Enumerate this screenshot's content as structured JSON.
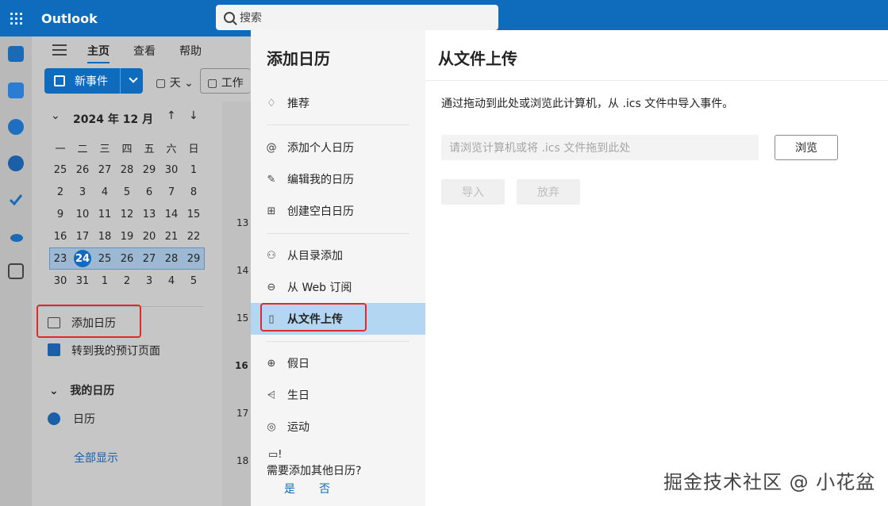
{
  "app": {
    "title": "Outlook"
  },
  "search": {
    "placeholder": "搜索"
  },
  "ribbon": {
    "tabs": [
      "主页",
      "查看",
      "帮助"
    ],
    "new_event": "新事件",
    "day": "天",
    "work": "工作"
  },
  "mini_calendar": {
    "header": "2024 年 12 月",
    "weekdays": [
      "一",
      "二",
      "三",
      "四",
      "五",
      "六",
      "日"
    ],
    "days": [
      "25",
      "26",
      "27",
      "28",
      "29",
      "30",
      "1",
      "2",
      "3",
      "4",
      "5",
      "6",
      "7",
      "8",
      "9",
      "10",
      "11",
      "12",
      "13",
      "14",
      "15",
      "16",
      "17",
      "18",
      "19",
      "20",
      "21",
      "22",
      "23",
      "24",
      "25",
      "26",
      "27",
      "28",
      "29",
      "30",
      "31",
      "1",
      "2",
      "3",
      "4",
      "5"
    ],
    "today": "24"
  },
  "sidebar": {
    "add_calendar": "添加日历",
    "goto_booking": "转到我的预订页面",
    "my_calendars": "我的日历",
    "calendar": "日历",
    "show_all": "全部显示"
  },
  "bg_rows": [
    "13",
    "14",
    "15",
    "16",
    "17",
    "18"
  ],
  "panel": {
    "title": "添加日历",
    "items": [
      {
        "label": "推荐",
        "icon": "lightbulb-icon"
      },
      {
        "label": "添加个人日历",
        "icon": "at-icon"
      },
      {
        "label": "编辑我的日历",
        "icon": "edit-calendar-icon"
      },
      {
        "label": "创建空白日历",
        "icon": "calendar-add-icon"
      },
      {
        "label": "从目录添加",
        "icon": "people-icon"
      },
      {
        "label": "从 Web 订阅",
        "icon": "link-icon"
      },
      {
        "label": "从文件上传",
        "icon": "file-upload-icon"
      },
      {
        "label": "假日",
        "icon": "globe-icon"
      },
      {
        "label": "生日",
        "icon": "cake-icon"
      },
      {
        "label": "运动",
        "icon": "sports-icon"
      }
    ],
    "question": "需要添加其他日历?",
    "yes": "是",
    "no": "否"
  },
  "content": {
    "title": "从文件上传",
    "description": "通过拖动到此处或浏览此计算机，从 .ics 文件中导入事件。",
    "drop_placeholder": "请浏览计算机或将 .ics 文件拖到此处",
    "browse": "浏览",
    "import": "导入",
    "discard": "放弃"
  },
  "watermark": "掘金技术社区 @ 小花盆",
  "colors": {
    "brand": "#0f6cbd",
    "selected": "#b3d6f2",
    "highlight": "#e0282d"
  }
}
